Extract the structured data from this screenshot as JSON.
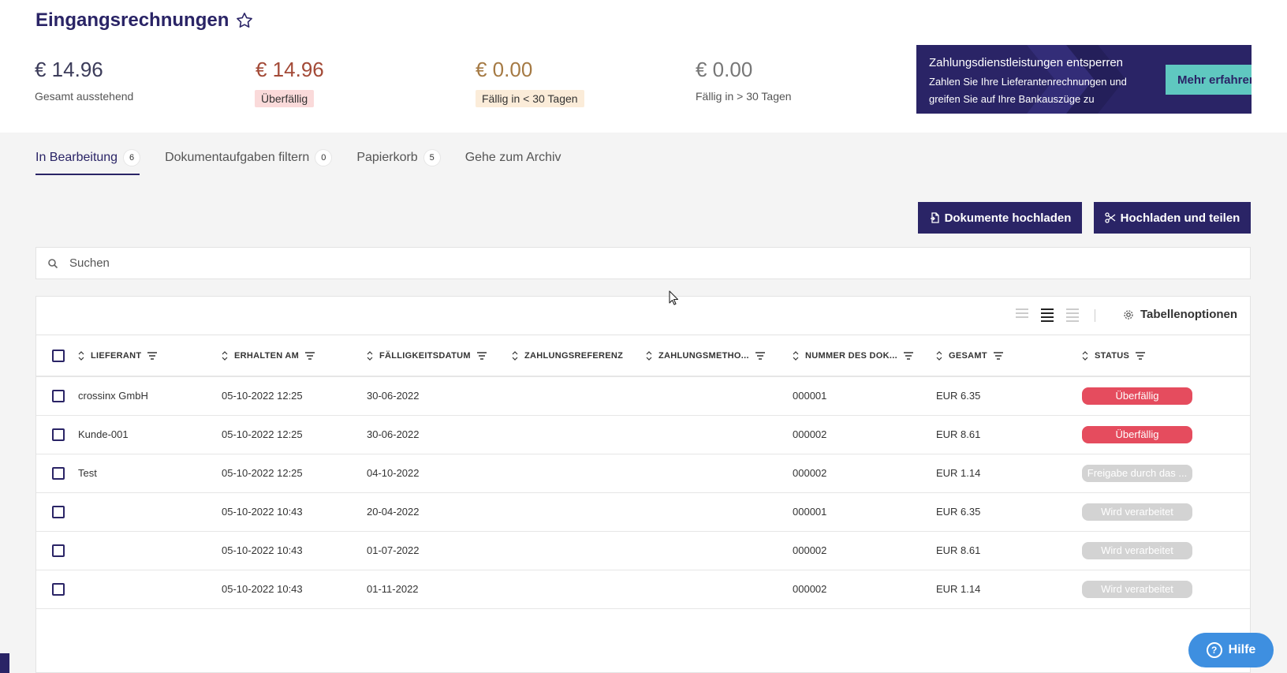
{
  "header": {
    "title": "Eingangsrechnungen",
    "favorite_icon": "star-outline-icon"
  },
  "stats": [
    {
      "amount": "€ 14.96",
      "label": "Gesamt ausstehend",
      "color": "#3c3c5a"
    },
    {
      "amount": "€ 14.96",
      "label": "Überfällig",
      "color": "#a34a37",
      "label_bg": "#fadada"
    },
    {
      "amount": "€ 0.00",
      "label": "Fällig in < 30 Tagen",
      "color": "#a57a44",
      "label_bg": "#fbecd9"
    },
    {
      "amount": "€ 0.00",
      "label": "Fällig in > 30 Tagen",
      "color": "#777777"
    }
  ],
  "promo": {
    "title": "Zahlungsdienstleistungen entsperren",
    "text": "Zahlen Sie Ihre Lieferantenrechnungen und greifen Sie auf Ihre Bankauszüge zu",
    "button": "Mehr erfahren",
    "bg": "#2a2466",
    "button_bg": "#5fc8c0"
  },
  "tabs": [
    {
      "label": "In Bearbeitung",
      "count": "6",
      "active": true
    },
    {
      "label": "Dokumentaufgaben filtern",
      "count": "0"
    },
    {
      "label": "Papierkorb",
      "count": "5"
    },
    {
      "label": "Gehe zum Archiv"
    }
  ],
  "actions": {
    "upload": "Dokumente hochladen",
    "upload_icon": "document-upload-icon",
    "split": "Hochladen und teilen",
    "split_icon": "scissors-icon"
  },
  "search": {
    "placeholder": "Suchen",
    "value": ""
  },
  "table_options": {
    "label": "Tabellenoptionen",
    "icon": "gear-icon"
  },
  "columns": [
    "LIEFERANT",
    "ERHALTEN AM",
    "FÄLLIGKEITSDATUM",
    "ZAHLUNGSREFERENZ",
    "ZAHLUNGSMETHO...",
    "NUMMER DES DOK...",
    "GESAMT",
    "STATUS"
  ],
  "rows": [
    {
      "supplier": "crossinx GmbH",
      "received": "05-10-2022 12:25",
      "due": "30-06-2022",
      "reference": "",
      "method": "",
      "doc_number": "000001",
      "total": "EUR 6.35",
      "status": "Überfällig",
      "status_type": "overdue"
    },
    {
      "supplier": "Kunde-001",
      "received": "05-10-2022 12:25",
      "due": "30-06-2022",
      "reference": "",
      "method": "",
      "doc_number": "000002",
      "total": "EUR 8.61",
      "status": "Überfällig",
      "status_type": "overdue"
    },
    {
      "supplier": "Test",
      "received": "05-10-2022 12:25",
      "due": "04-10-2022",
      "reference": "",
      "method": "",
      "doc_number": "000002",
      "total": "EUR 1.14",
      "status": "Freigabe durch das ...",
      "status_type": "grey"
    },
    {
      "supplier": "",
      "received": "05-10-2022 10:43",
      "due": "20-04-2022",
      "reference": "",
      "method": "",
      "doc_number": "000001",
      "total": "EUR 6.35",
      "status": "Wird verarbeitet",
      "status_type": "grey"
    },
    {
      "supplier": "",
      "received": "05-10-2022 10:43",
      "due": "01-07-2022",
      "reference": "",
      "method": "",
      "doc_number": "000002",
      "total": "EUR 8.61",
      "status": "Wird verarbeitet",
      "status_type": "grey"
    },
    {
      "supplier": "",
      "received": "05-10-2022 10:43",
      "due": "01-11-2022",
      "reference": "",
      "method": "",
      "doc_number": "000002",
      "total": "EUR 1.14",
      "status": "Wird verarbeitet",
      "status_type": "grey"
    }
  ],
  "help": {
    "label": "Hilfe",
    "icon": "question-circle-icon",
    "bg": "#3e8fe0"
  },
  "colors": {
    "primary": "#2a2466",
    "overdue": "#e54c5e",
    "pending": "#d3d3d3"
  }
}
